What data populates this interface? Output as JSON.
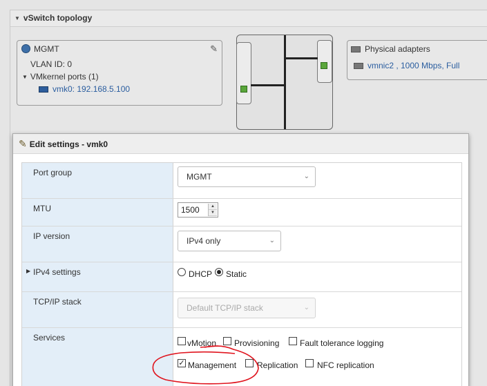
{
  "topology": {
    "title": "vSwitch topology",
    "port_group": {
      "name": "MGMT",
      "vlan": "VLAN ID: 0",
      "vmkernel_ports": "VMkernel ports (1)",
      "vmk": "vmk0: 192.168.5.100"
    },
    "physical_adapters": {
      "title": "Physical adapters",
      "nic": "vmnic2 , 1000 Mbps, Full"
    }
  },
  "modal": {
    "title": "Edit settings - vmk0",
    "fields": {
      "port_group": {
        "label": "Port group",
        "value": "MGMT"
      },
      "mtu": {
        "label": "MTU",
        "value": "1500"
      },
      "ip_version": {
        "label": "IP version",
        "value": "IPv4 only"
      },
      "ipv4_settings": {
        "label": "IPv4 settings",
        "dhcp": "DHCP",
        "static": "Static",
        "selected": "Static"
      },
      "tcpip_stack": {
        "label": "TCP/IP stack",
        "value": "Default TCP/IP stack"
      },
      "services": {
        "label": "Services",
        "vmotion": {
          "label": "vMotion",
          "checked": false
        },
        "provisioning": {
          "label": "Provisioning",
          "checked": false
        },
        "fault_tolerance": {
          "label": "Fault tolerance logging",
          "checked": false
        },
        "management": {
          "label": "Management",
          "checked": true
        },
        "replication": {
          "label": "Replication",
          "checked": false
        },
        "nfc_replication": {
          "label": "NFC replication",
          "checked": false
        }
      }
    }
  },
  "colors": {
    "label_bg": "#e3eef8",
    "link_blue": "#2a5d9f",
    "port_green": "#5aa63b",
    "annotation_red": "#e0141e"
  },
  "icons": [
    "caret-down-icon",
    "globe-icon",
    "pencil-icon",
    "nic-icon",
    "chevron-down-icon",
    "expand-icon"
  ]
}
